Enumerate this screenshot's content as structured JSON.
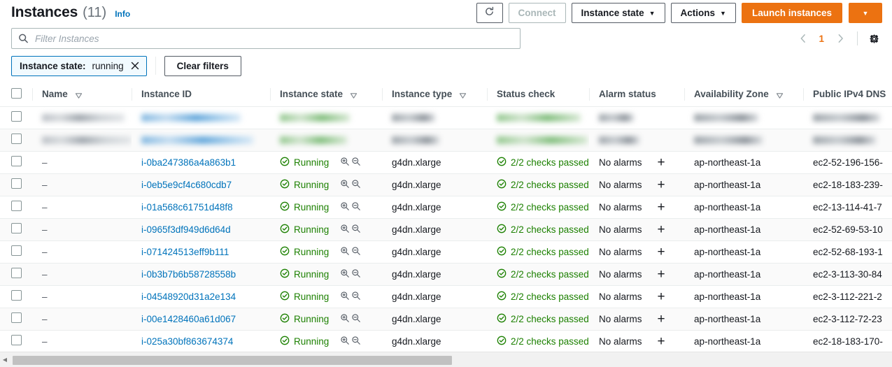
{
  "header": {
    "title": "Instances",
    "count": "(11)",
    "info_label": "Info",
    "refresh_icon": "refresh-icon",
    "connect_label": "Connect",
    "instance_state_label": "Instance state",
    "actions_label": "Actions",
    "launch_label": "Launch instances",
    "launch_caret_icon": "chevron-down-icon"
  },
  "search": {
    "placeholder": "Filter Instances",
    "value": "",
    "icon": "search-icon"
  },
  "pagination": {
    "prev_icon": "chevron-left-icon",
    "page": "1",
    "next_icon": "chevron-right-icon",
    "settings_icon": "gear-icon"
  },
  "filters": {
    "token_key": "Instance state:",
    "token_value": "running",
    "token_remove_icon": "close-icon",
    "clear_label": "Clear filters"
  },
  "table": {
    "columns": [
      {
        "label": "Name",
        "sortable": true
      },
      {
        "label": "Instance ID",
        "sortable": false
      },
      {
        "label": "Instance state",
        "sortable": true
      },
      {
        "label": "Instance type",
        "sortable": true
      },
      {
        "label": "Status check",
        "sortable": false
      },
      {
        "label": "Alarm status",
        "sortable": false
      },
      {
        "label": "Availability Zone",
        "sortable": true
      },
      {
        "label": "Public IPv4 DNS",
        "sortable": false
      }
    ],
    "state_text": "Running",
    "check_text": "2/2 checks passed",
    "alarm_text": "No alarms",
    "name_dash": "–",
    "redacted_rows": 2,
    "rows": [
      {
        "name": "–",
        "id": "i-0ba247386a4a863b1",
        "state": "Running",
        "type": "g4dn.xlarge",
        "check": "2/2 checks passed",
        "alarm": "No alarms",
        "az": "ap-northeast-1a",
        "dns": "ec2-52-196-156-"
      },
      {
        "name": "–",
        "id": "i-0eb5e9cf4c680cdb7",
        "state": "Running",
        "type": "g4dn.xlarge",
        "check": "2/2 checks passed",
        "alarm": "No alarms",
        "az": "ap-northeast-1a",
        "dns": "ec2-18-183-239-"
      },
      {
        "name": "–",
        "id": "i-01a568c61751d48f8",
        "state": "Running",
        "type": "g4dn.xlarge",
        "check": "2/2 checks passed",
        "alarm": "No alarms",
        "az": "ap-northeast-1a",
        "dns": "ec2-13-114-41-7"
      },
      {
        "name": "–",
        "id": "i-0965f3df949d6d64d",
        "state": "Running",
        "type": "g4dn.xlarge",
        "check": "2/2 checks passed",
        "alarm": "No alarms",
        "az": "ap-northeast-1a",
        "dns": "ec2-52-69-53-10"
      },
      {
        "name": "–",
        "id": "i-071424513eff9b111",
        "state": "Running",
        "type": "g4dn.xlarge",
        "check": "2/2 checks passed",
        "alarm": "No alarms",
        "az": "ap-northeast-1a",
        "dns": "ec2-52-68-193-1"
      },
      {
        "name": "–",
        "id": "i-0b3b7b6b58728558b",
        "state": "Running",
        "type": "g4dn.xlarge",
        "check": "2/2 checks passed",
        "alarm": "No alarms",
        "az": "ap-northeast-1a",
        "dns": "ec2-3-113-30-84"
      },
      {
        "name": "–",
        "id": "i-04548920d31a2e134",
        "state": "Running",
        "type": "g4dn.xlarge",
        "check": "2/2 checks passed",
        "alarm": "No alarms",
        "az": "ap-northeast-1a",
        "dns": "ec2-3-112-221-2"
      },
      {
        "name": "–",
        "id": "i-00e1428460a61d067",
        "state": "Running",
        "type": "g4dn.xlarge",
        "check": "2/2 checks passed",
        "alarm": "No alarms",
        "az": "ap-northeast-1a",
        "dns": "ec2-3-112-72-23"
      },
      {
        "name": "–",
        "id": "i-025a30bf863674374",
        "state": "Running",
        "type": "g4dn.xlarge",
        "check": "2/2 checks passed",
        "alarm": "No alarms",
        "az": "ap-northeast-1a",
        "dns": "ec2-18-183-170-"
      }
    ]
  },
  "colors": {
    "accent_orange": "#ec7211",
    "link_blue": "#0073bb",
    "success_green": "#1d8102",
    "border_grey": "#eaeded"
  }
}
